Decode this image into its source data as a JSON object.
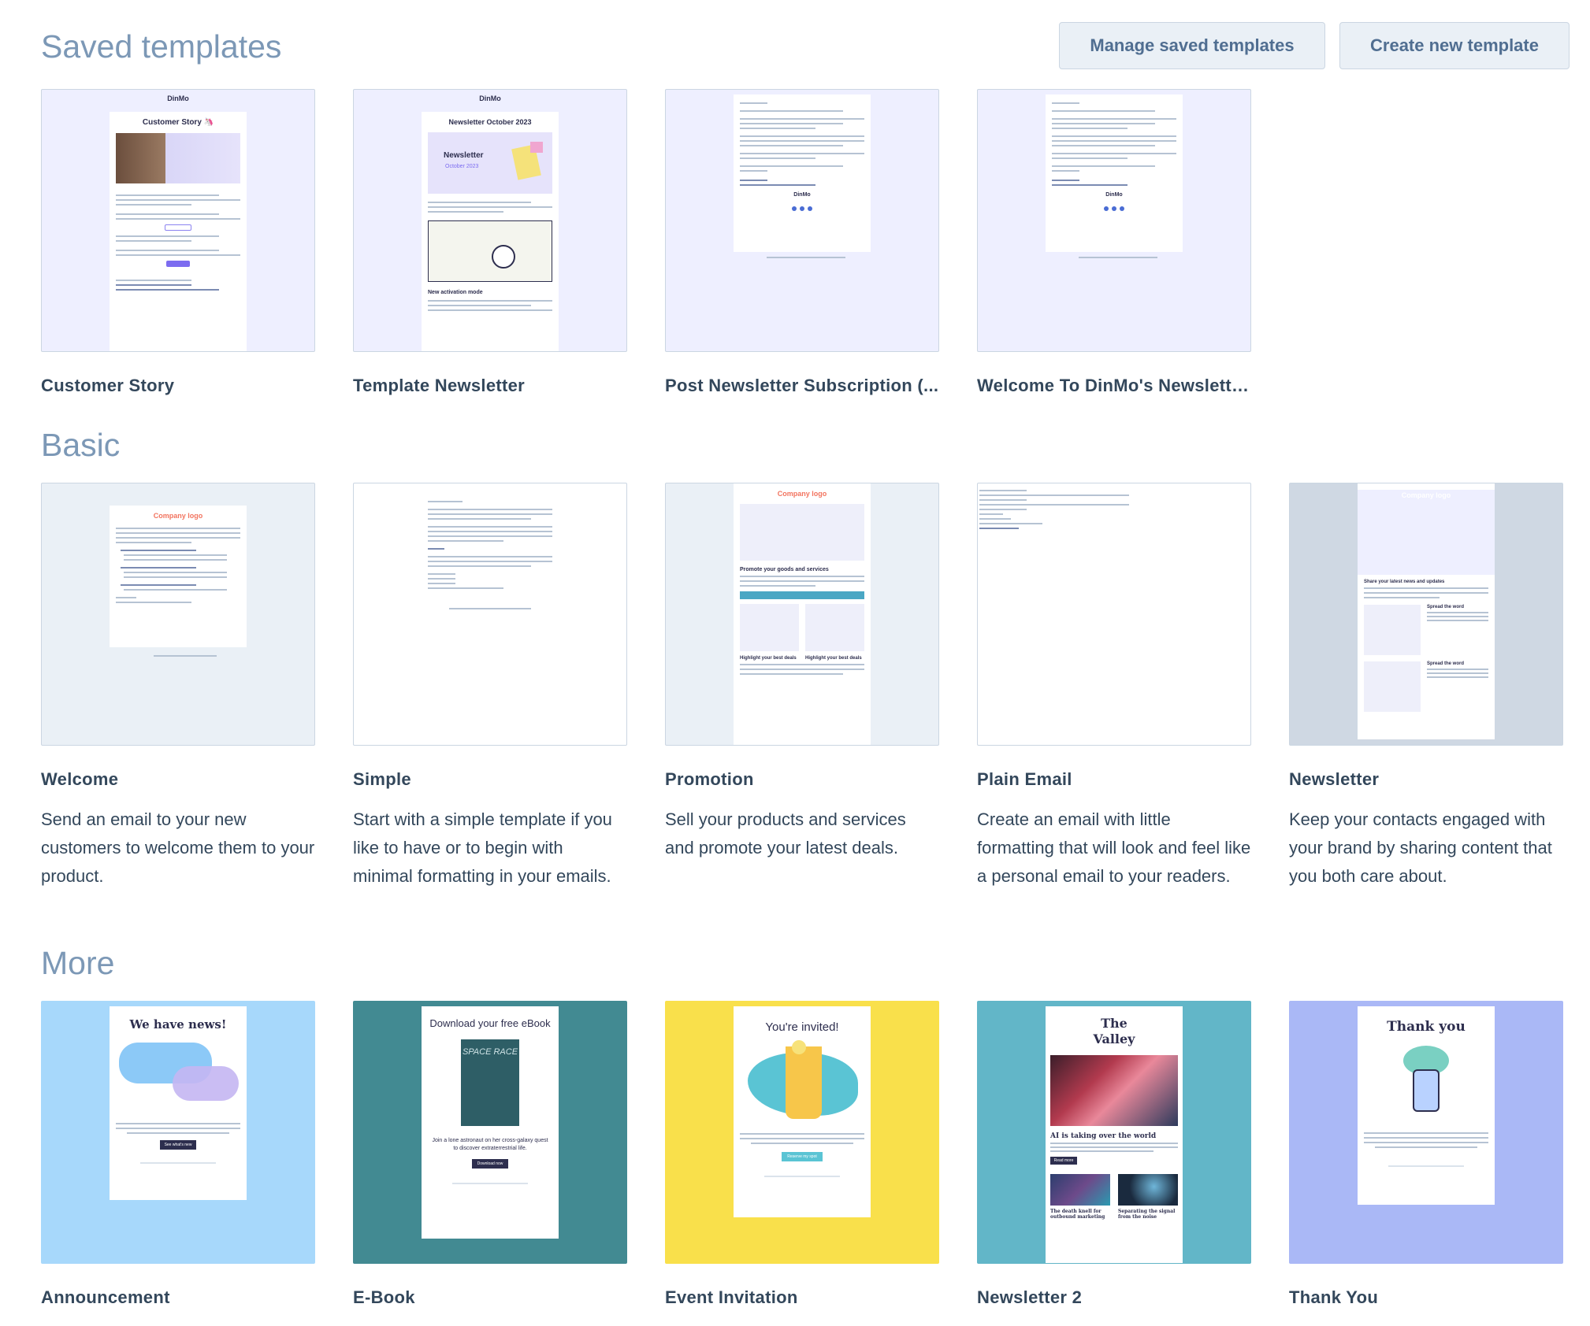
{
  "sections": {
    "saved": "Saved templates",
    "basic": "Basic",
    "more": "More"
  },
  "buttons": {
    "manage": "Manage saved templates",
    "create": "Create new template"
  },
  "saved_templates": [
    {
      "name": "Customer Story",
      "thumb_title": "Customer Story 🦄",
      "thumb_logo": "DinMo"
    },
    {
      "name": "Template Newsletter",
      "thumb_title": "Newsletter October 2023",
      "thumb_logo": "DinMo",
      "thumb_badge": "Newsletter",
      "thumb_badge_sub": "October 2023",
      "thumb_section": "New activation mode"
    },
    {
      "name": "Post Newsletter Subscription (...",
      "thumb_logo": "DinMo"
    },
    {
      "name": "Welcome To DinMo's Newslette...",
      "thumb_logo": "DinMo"
    }
  ],
  "basic_templates": [
    {
      "name": "Welcome",
      "desc": "Send an email to your new customers to welcome them to your product.",
      "thumb_logo": "Company logo"
    },
    {
      "name": "Simple",
      "desc": "Start with a simple template if you like to have or to begin with minimal formatting in your emails."
    },
    {
      "name": "Promotion",
      "desc": "Sell your products and services and promote your latest deals.",
      "thumb_logo": "Company logo",
      "thumb_heading": "Promote your goods and services",
      "thumb_sub1": "Highlight your best deals",
      "thumb_sub2": "Highlight your best deals"
    },
    {
      "name": "Plain Email",
      "desc": "Create an email with little formatting that will look and feel like a personal email to your readers."
    },
    {
      "name": "Newsletter",
      "desc": "Keep your contacts engaged with your brand by sharing content that you both care about.",
      "thumb_logo": "Company logo",
      "thumb_heading": "Share your latest news and updates",
      "thumb_sub1": "Spread the word",
      "thumb_sub2": "Spread the word"
    }
  ],
  "more_templates": [
    {
      "name": "Announcement",
      "thumb_title": "We have news!",
      "thumb_button": "See what's new"
    },
    {
      "name": "E-Book",
      "thumb_title": "Download your free eBook",
      "thumb_book": "SPACE RACE",
      "thumb_body": "Join a lone astronaut on her cross-galaxy quest to discover extraterrestrial life.",
      "thumb_button": "Download now"
    },
    {
      "name": "Event Invitation",
      "thumb_title": "You're invited!",
      "thumb_button": "Reserve my spot"
    },
    {
      "name": "Newsletter 2",
      "thumb_title": "The Valley",
      "thumb_headline": "AI is taking over the world",
      "thumb_button": "Read more",
      "thumb_sub1": "The death knell for outbound marketing",
      "thumb_sub2": "Separating the signal from the noise"
    },
    {
      "name": "Thank You",
      "thumb_title": "Thank you"
    }
  ],
  "colors": {
    "heading": "#7c98b6",
    "text": "#33475b",
    "announcement_bg": "#a7d8fb",
    "ebook_bg": "#428a92",
    "event_bg": "#f9e04b",
    "newsletter2_bg": "#62b6c8",
    "thankyou_bg": "#aab8f6"
  }
}
